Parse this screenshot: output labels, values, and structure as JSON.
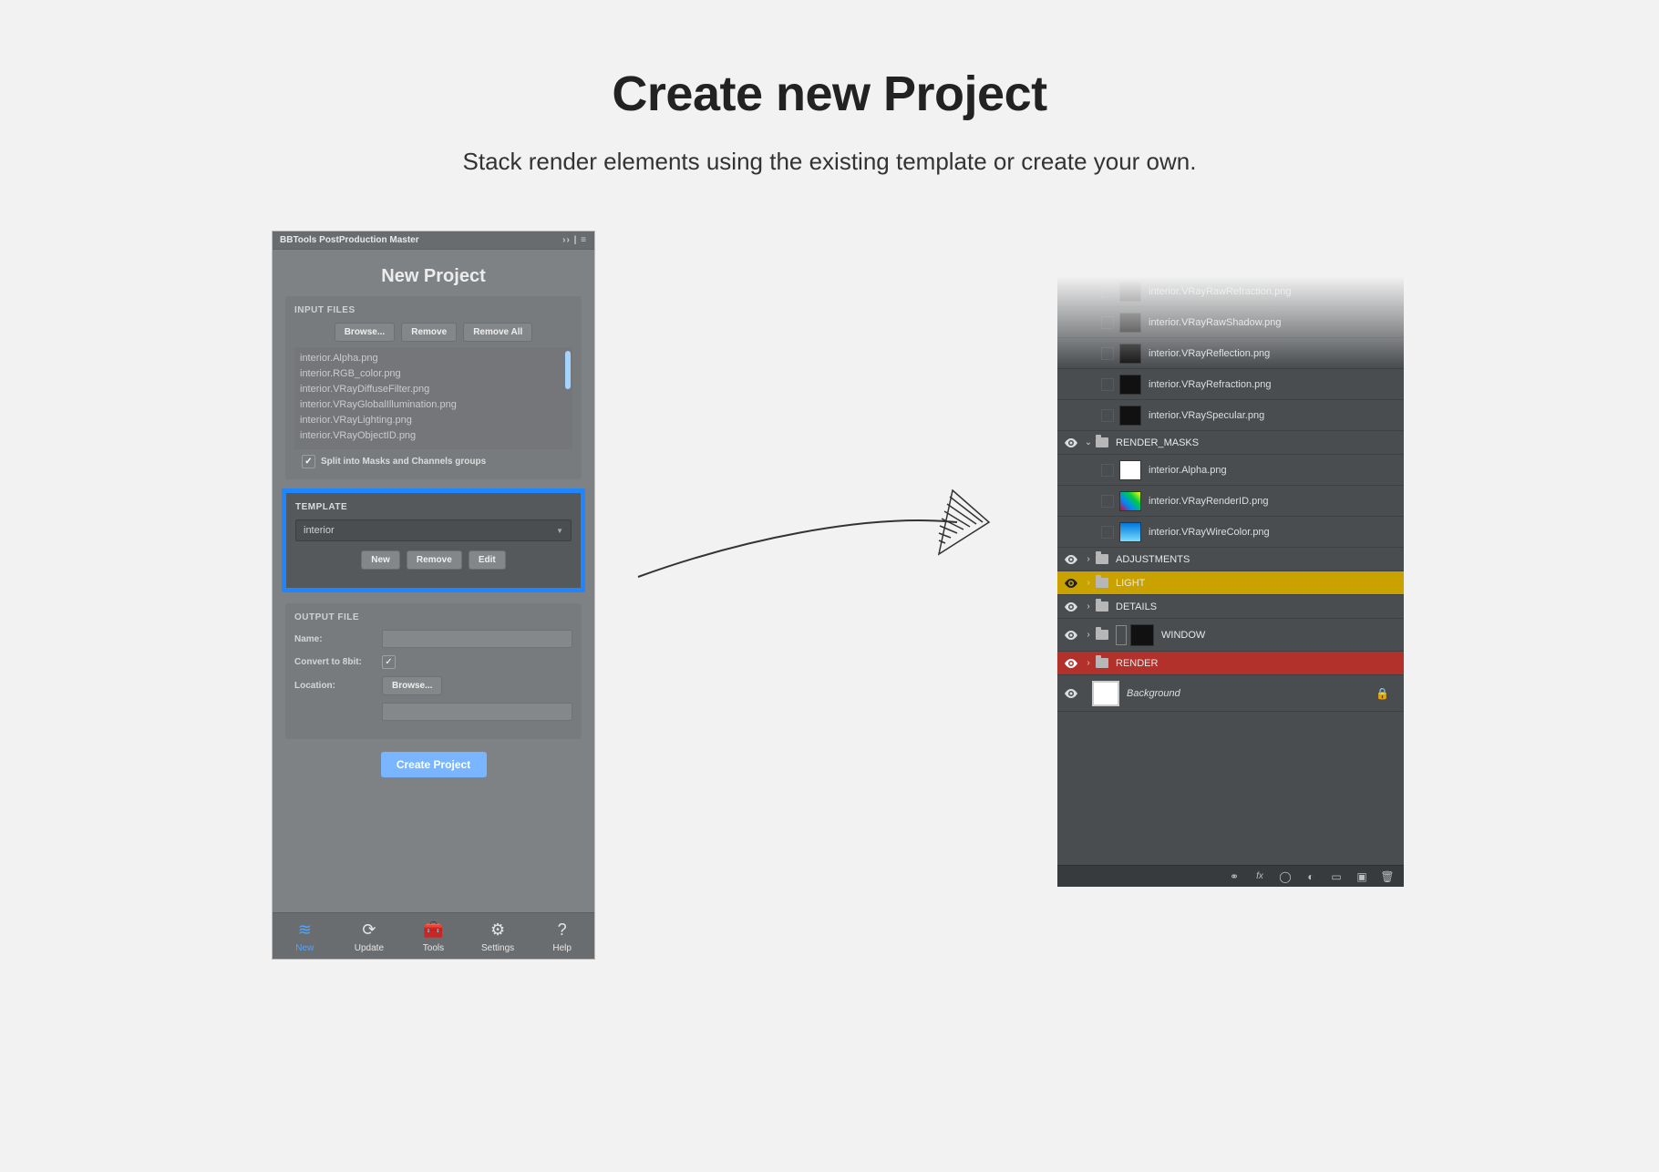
{
  "page": {
    "title": "Create new Project",
    "subtitle": "Stack render elements using the existing template or create your own."
  },
  "panel": {
    "header": "BBTools PostProduction Master",
    "title": "New Project",
    "input_files": {
      "label": "INPUT FILES",
      "browse": "Browse...",
      "remove": "Remove",
      "remove_all": "Remove All",
      "files": [
        "interior.Alpha.png",
        "interior.RGB_color.png",
        "interior.VRayDiffuseFilter.png",
        "interior.VRayGlobalIllumination.png",
        "interior.VRayLighting.png",
        "interior.VRayObjectID.png"
      ],
      "split_label": "Split into Masks and Channels groups"
    },
    "template": {
      "label": "TEMPLATE",
      "selected": "interior",
      "new": "New",
      "remove": "Remove",
      "edit": "Edit"
    },
    "output": {
      "label": "OUTPUT FILE",
      "name_label": "Name:",
      "convert_label": "Convert to 8bit:",
      "location_label": "Location:",
      "browse": "Browse..."
    },
    "create": "Create Project",
    "nav": {
      "new": "New",
      "update": "Update",
      "tools": "Tools",
      "settings": "Settings",
      "help": "Help"
    }
  },
  "layers": {
    "items": [
      "interior.VRayRawRefraction.png",
      "interior.VRayRawShadow.png",
      "interior.VRayReflection.png",
      "interior.VRayRefraction.png",
      "interior.VRaySpecular.png"
    ],
    "masks_group": "RENDER_MASKS",
    "mask_items": [
      "interior.Alpha.png",
      "interior.VRayRenderID.png",
      "interior.VRayWireColor.png"
    ],
    "groups": {
      "adjustments": "ADJUSTMENTS",
      "light": "LIGHT",
      "details": "DETAILS",
      "window": "WINDOW",
      "render": "RENDER"
    },
    "background": "Background"
  }
}
